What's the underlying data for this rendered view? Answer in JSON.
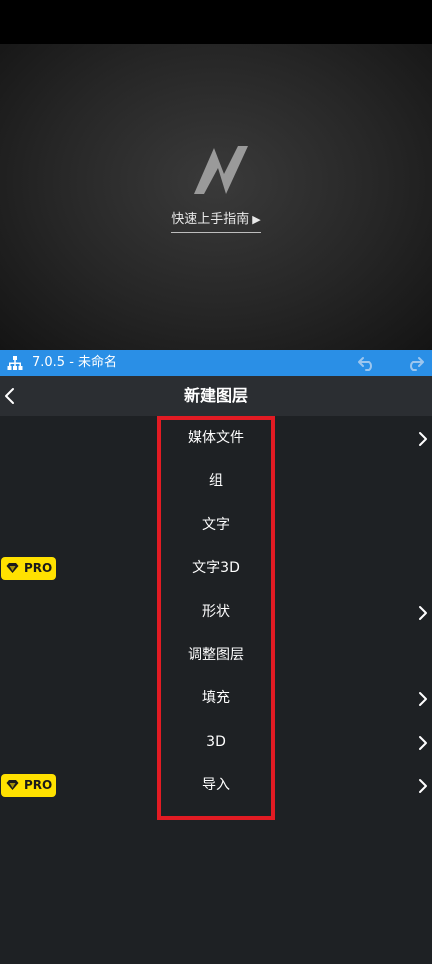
{
  "preview": {
    "logo_icon": "n-logo-icon",
    "guide_label": "快速上手指南",
    "guide_play_glyph": "▶"
  },
  "appbar": {
    "version_title": "7.0.5 - 未命名",
    "color": "#2a8fe6",
    "icons": [
      "layers-icon",
      "undo-icon",
      "redo-icon"
    ]
  },
  "header": {
    "title": "新建图层",
    "back_icon": "back-icon"
  },
  "menu": {
    "items": [
      {
        "label": "媒体文件",
        "has_submenu": true,
        "pro": false
      },
      {
        "label": "组",
        "has_submenu": false,
        "pro": false
      },
      {
        "label": "文字",
        "has_submenu": false,
        "pro": false
      },
      {
        "label": "文字3D",
        "has_submenu": false,
        "pro": true
      },
      {
        "label": "形状",
        "has_submenu": true,
        "pro": false
      },
      {
        "label": "调整图层",
        "has_submenu": false,
        "pro": false
      },
      {
        "label": "填充",
        "has_submenu": true,
        "pro": false
      },
      {
        "label": "3D",
        "has_submenu": true,
        "pro": false
      },
      {
        "label": "导入",
        "has_submenu": true,
        "pro": true
      }
    ],
    "pro_label": "PRO",
    "pro_color": "#ffe100"
  },
  "highlight_color": "#e21b23"
}
